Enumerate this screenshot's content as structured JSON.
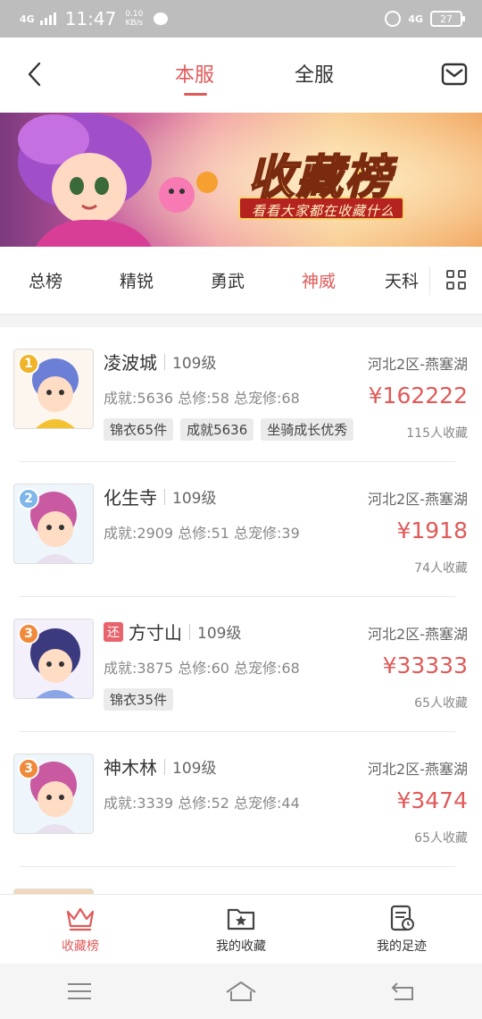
{
  "status_bar": {
    "network": "4G",
    "time": "11:47",
    "speed_value": "0.10",
    "speed_unit": "KB/s",
    "network_right": "4G",
    "battery": "27"
  },
  "header": {
    "tabs": [
      {
        "label": "本服",
        "active": true
      },
      {
        "label": "全服",
        "active": false
      }
    ]
  },
  "banner": {
    "title": "收藏榜",
    "subtitle": "看看大家都在收藏什么"
  },
  "categories": [
    {
      "label": "总榜",
      "active": false
    },
    {
      "label": "精锐",
      "active": false
    },
    {
      "label": "勇武",
      "active": false
    },
    {
      "label": "神威",
      "active": true
    },
    {
      "label": "天科",
      "active": false
    }
  ],
  "items": [
    {
      "rank": "1",
      "rank_color": "#f0b429",
      "avatar_color": "#6b7fd6",
      "returning": false,
      "name": "凌波城",
      "level": "109级",
      "server": "河北2区-燕塞湖",
      "stats": "成就:5636 总修:58 总宠修:68",
      "price": "¥162222",
      "tags": [
        "锦衣65件",
        "成就5636",
        "坐骑成长优秀"
      ],
      "favorites": "115人收藏"
    },
    {
      "rank": "2",
      "rank_color": "#7db6e8",
      "avatar_color": "#c95aa1",
      "returning": false,
      "name": "化生寺",
      "level": "109级",
      "server": "河北2区-燕塞湖",
      "stats": "成就:2909 总修:51 总宠修:39",
      "price": "¥1918",
      "tags": [],
      "favorites": "74人收藏"
    },
    {
      "rank": "3",
      "rank_color": "#f08a3a",
      "avatar_color": "#4a4fa8",
      "returning": true,
      "return_label": "还",
      "name": "方寸山",
      "level": "109级",
      "server": "河北2区-燕塞湖",
      "stats": "成就:3875 总修:60 总宠修:68",
      "price": "¥33333",
      "tags": [
        "锦衣35件"
      ],
      "favorites": "65人收藏"
    },
    {
      "rank": "3",
      "rank_color": "#f08a3a",
      "avatar_color": "#c95aa1",
      "returning": false,
      "name": "神木林",
      "level": "109级",
      "server": "河北2区-燕塞湖",
      "stats": "成就:3339 总修:52 总宠修:44",
      "price": "¥3474",
      "tags": [],
      "favorites": "65人收藏"
    }
  ],
  "bottom_nav": [
    {
      "label": "收藏榜",
      "icon": "crown-icon",
      "active": true
    },
    {
      "label": "我的收藏",
      "icon": "star-folder-icon",
      "active": false
    },
    {
      "label": "我的足迹",
      "icon": "history-icon",
      "active": false
    }
  ],
  "colors": {
    "accent": "#e05a5a"
  }
}
